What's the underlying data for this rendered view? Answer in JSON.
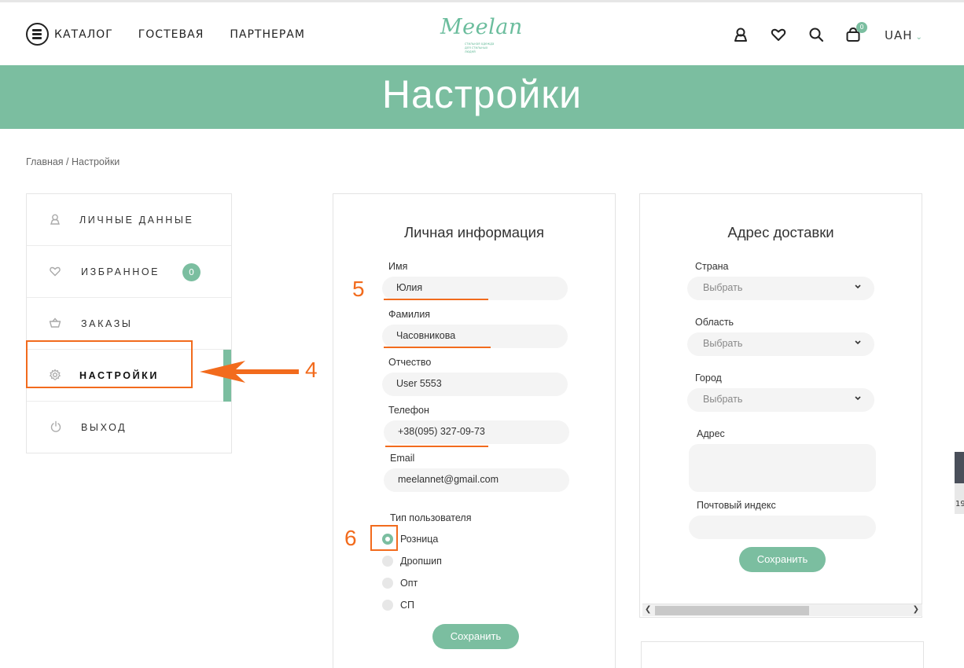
{
  "header": {
    "catalog_label": "КАТАЛОГ",
    "nav": [
      "ГОСТЕВАЯ",
      "ПАРТНЕРАМ"
    ],
    "logo_text": "Meelan",
    "logo_tagline": "стильная одежда для стильных людей",
    "cart_count": "0",
    "currency": "UAH",
    "icons": [
      "user-icon",
      "heart-icon",
      "search-icon",
      "cart-icon"
    ]
  },
  "banner": {
    "title": "Настройки"
  },
  "breadcrumb": {
    "home": "Главная",
    "separator": " / ",
    "current": "Настройки"
  },
  "sidebar": {
    "items": [
      {
        "label": "ЛИЧНЫЕ ДАННЫЕ",
        "icon": "user-icon"
      },
      {
        "label": "ИЗБРАННОЕ",
        "icon": "heart-icon",
        "badge": "0"
      },
      {
        "label": "ЗАКАЗЫ",
        "icon": "basket-icon"
      },
      {
        "label": "НАСТРОЙКИ",
        "icon": "gear-icon",
        "active": true
      },
      {
        "label": "ВЫХОД",
        "icon": "power-icon"
      }
    ]
  },
  "personal": {
    "title": "Личная информация",
    "fields": [
      {
        "label": "Имя",
        "value": "Юлия"
      },
      {
        "label": "Фамилия",
        "value": "Часовникова"
      },
      {
        "label": "Отчество",
        "value": "User 5553"
      },
      {
        "label": "Телефон",
        "value": "+38(095) 327-09-73"
      },
      {
        "label": "Email",
        "value": "meelannet@gmail.com"
      }
    ],
    "user_type_label": "Тип пользователя",
    "user_types": [
      {
        "label": "Розница",
        "selected": true
      },
      {
        "label": "Дропшип",
        "selected": false
      },
      {
        "label": "Опт",
        "selected": false
      },
      {
        "label": "СП",
        "selected": false
      }
    ],
    "save_label": "Сохранить"
  },
  "delivery": {
    "title": "Адрес доставки",
    "country_label": "Страна",
    "country_value": "Выбрать",
    "region_label": "Область",
    "region_value": "Выбрать",
    "city_label": "Город",
    "city_value": "Выбрать",
    "address_label": "Адрес",
    "address_value": "",
    "zip_label": "Почтовый индекс",
    "zip_value": "",
    "save_label": "Сохранить"
  },
  "annotations": {
    "n4": "4",
    "n5": "5",
    "n6": "6"
  },
  "edge_fragment": "19",
  "colors": {
    "accent": "#7bbea0",
    "annotation": "#f26b1d"
  }
}
